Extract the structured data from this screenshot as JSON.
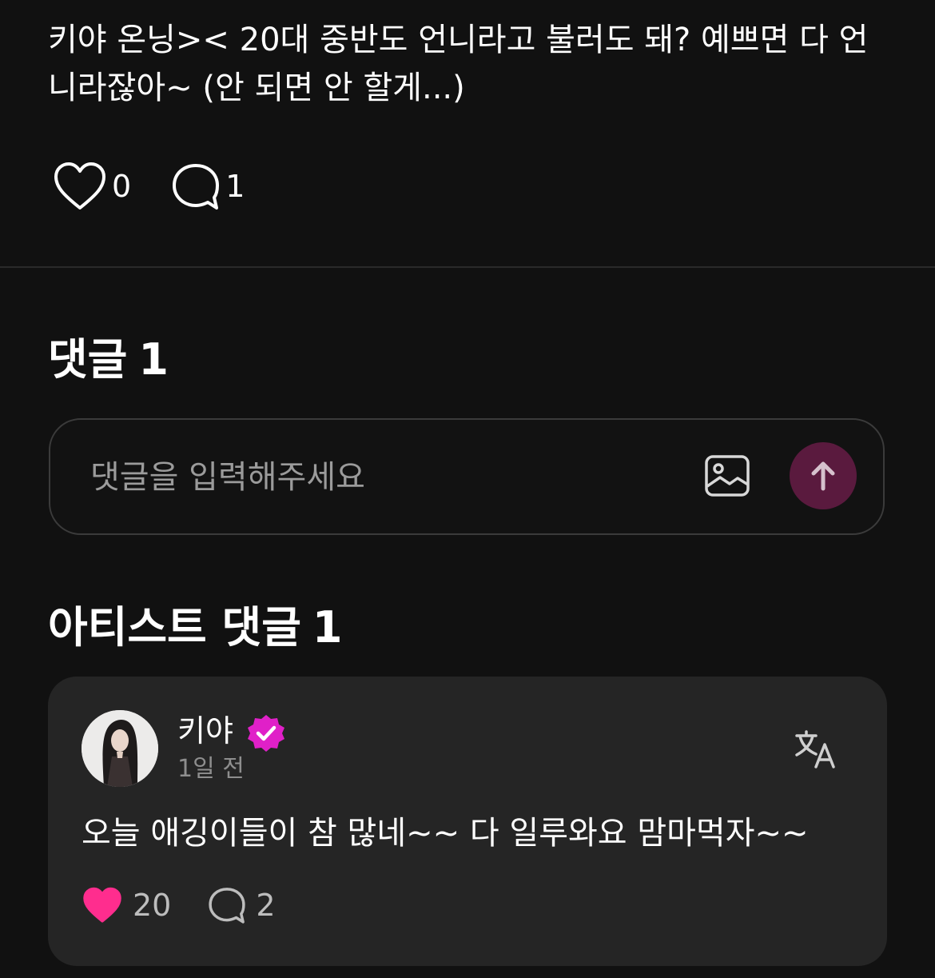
{
  "post": {
    "text": "키야 온닝>< 20대 중반도 언니라고 불러도 돼? 예쁘면 다 언\n니라잖아~ (안 되면 안 할게...)",
    "like_count": "0",
    "comment_count": "1"
  },
  "comments_section": {
    "title": "댓글",
    "count": "1",
    "input_placeholder": "댓글을 입력해주세요",
    "send_button_color": "#5a1a3e"
  },
  "artist_section": {
    "title": "아티스트 댓글",
    "count": "1"
  },
  "artist_comment": {
    "author": "키야",
    "verified_badge_color": "#e020c8",
    "time": "1일 전",
    "text": "오늘 애깅이들이 참 많네~~ 다 일루와요 맘마먹자~~",
    "like_count": "20",
    "reply_count": "2",
    "liked": true,
    "like_color": "#ff2d8e"
  },
  "icons": [
    "heart-icon",
    "comment-icon",
    "image-icon",
    "arrow-up-icon",
    "verified-badge-icon",
    "translate-icon"
  ]
}
